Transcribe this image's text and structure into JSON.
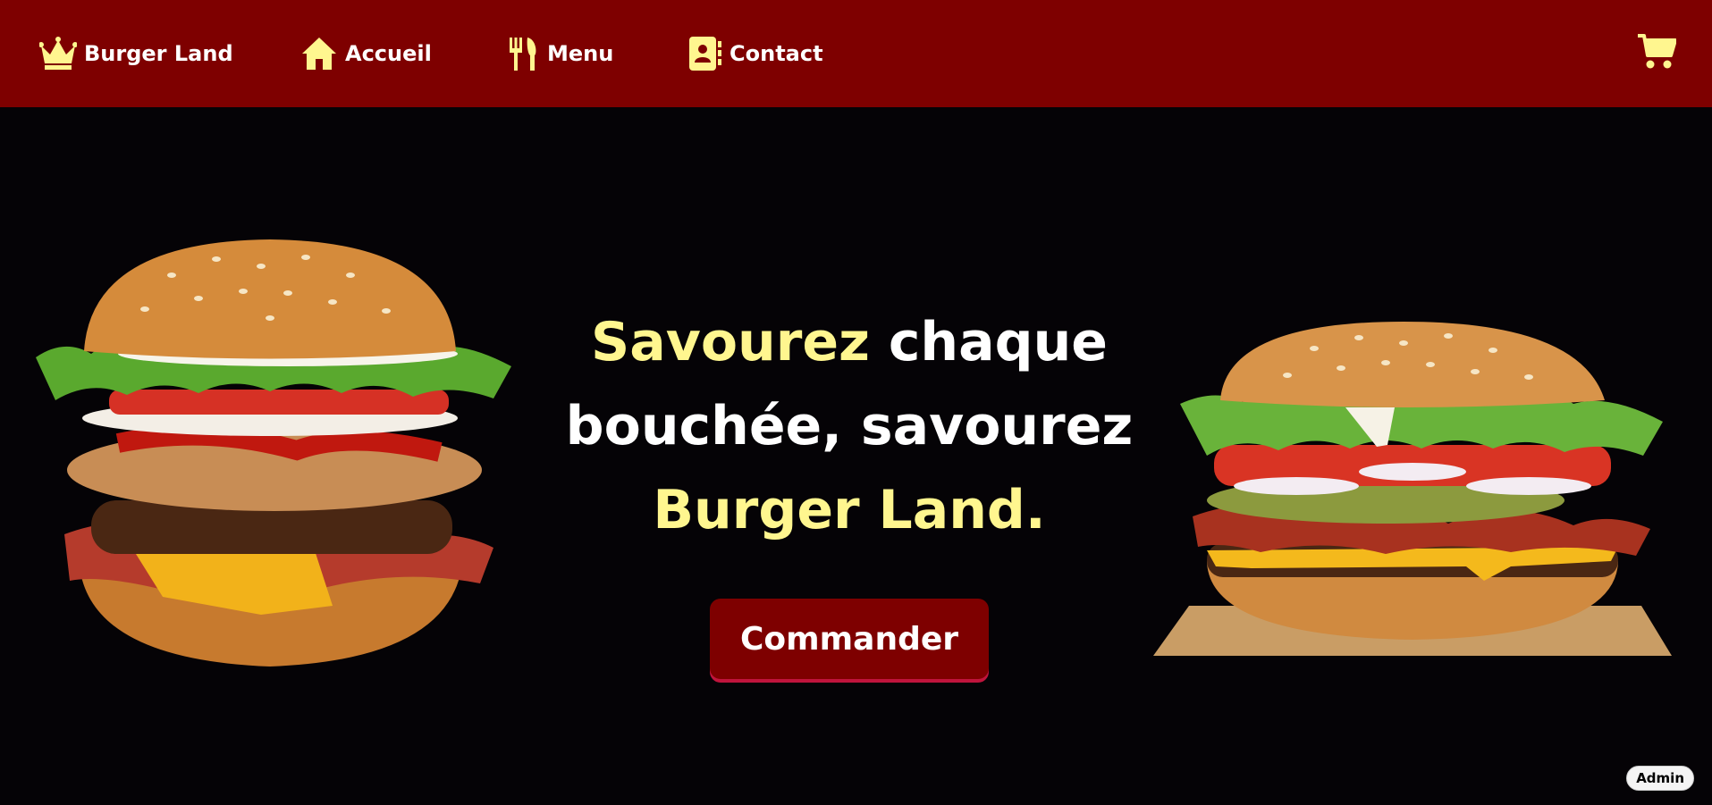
{
  "nav": {
    "brand": {
      "label": "Burger Land",
      "icon": "crown-icon"
    },
    "items": [
      {
        "label": "Accueil",
        "icon": "home-icon"
      },
      {
        "label": "Menu",
        "icon": "utensils-icon"
      },
      {
        "label": "Contact",
        "icon": "contact-book-icon"
      }
    ],
    "cart_icon": "shopping-cart-icon"
  },
  "hero": {
    "headline_part1": "Savourez",
    "headline_part2": " chaque bouchée, savourez ",
    "headline_part3": "Burger Land.",
    "cta_label": "Commander"
  },
  "admin_label": "Admin",
  "colors": {
    "nav_bg": "#7e0000",
    "accent_yellow": "#fff68f",
    "page_bg": "#050306",
    "cta_bg": "#7e0000"
  }
}
